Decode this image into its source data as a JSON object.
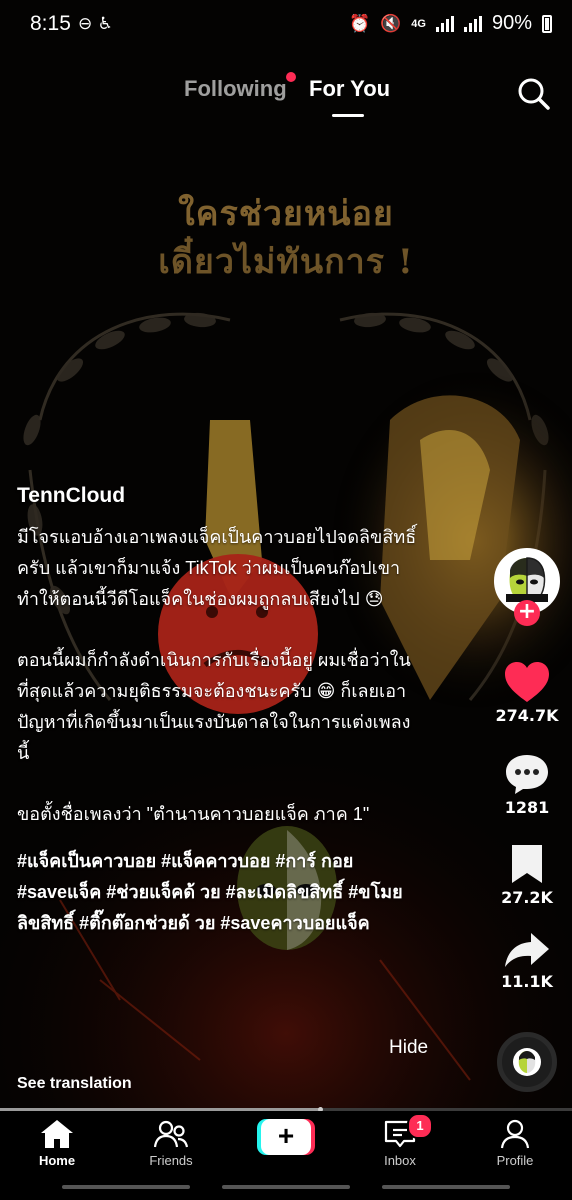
{
  "status_bar": {
    "time": "8:15",
    "network": "4G",
    "battery": "90%"
  },
  "top_tabs": {
    "following": "Following",
    "for_you": "For You"
  },
  "video_overlay": {
    "line1": "ใครช่วยหน่อย",
    "line2": "เดี๋ยวไม่ทันการ !"
  },
  "caption": {
    "author": "TennCloud",
    "paragraphs": [
      "มีโจรแอบอ้างเอาเพลงแจ็คเป็นคาวบอยไปจดลิขสิทธิ์ครับ แล้วเขาก็มาแจ้ง TikTok ว่าผมเป็นคนก๊อปเขาทำให้ตอนนี้วีดีโอแจ็คในช่องผมถูกลบเสียงไป 😓",
      "ตอนนี้ผมก็กำลังดำเนินการกับเรื่องนี้อยู่ ผมเชื่อว่าในที่สุดแล้วความยุติธรรมจะต้องชนะครับ 😁 ก็เลยเอาปัญหาที่เกิดขึ้นมาเป็นแรงบันดาลใจในการแต่งเพลงนี้",
      "ขอตั้งชื่อเพลงว่า \"ตำนานคาวบอยแจ็ค ภาค 1\""
    ],
    "hashtags": "#แจ็คเป็นคาวบอย #แจ็คคาวบอย #การ์ กอย #saveแจ็ค #ช่วยแจ็คด้ วย #ละเมิดลิขสิทธิ์ #ขโมยลิขสิทธิ์ #ติ๊กต๊อกช่วยด้ วย #saveคาวบอยแจ็ค",
    "hide": "Hide",
    "see_translation": "See translation"
  },
  "rail": {
    "likes": "274.7K",
    "comments": "1281",
    "saves": "27.2K",
    "shares": "11.1K",
    "follow_symbol": "+"
  },
  "progress": {
    "fraction": 0.56
  },
  "bottom_nav": {
    "home": "Home",
    "friends": "Friends",
    "create_symbol": "+",
    "inbox": "Inbox",
    "inbox_badge": "1",
    "profile": "Profile"
  },
  "colors": {
    "accent": "#fe2c55",
    "cyan": "#25f4ee"
  }
}
